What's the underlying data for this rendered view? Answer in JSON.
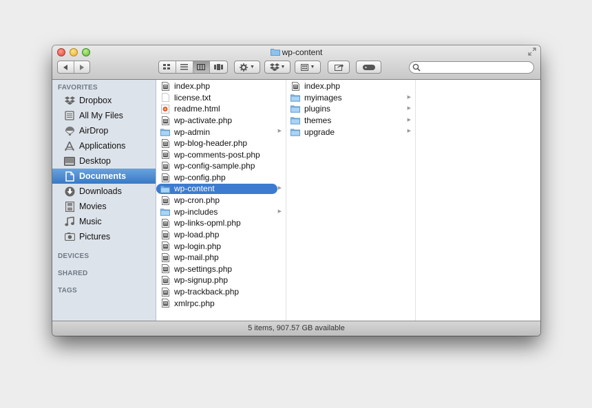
{
  "window": {
    "title": "wp-content"
  },
  "toolbar": {
    "search": {
      "placeholder": "",
      "value": ""
    }
  },
  "sidebar": {
    "favorites_header": "FAVORITES",
    "items": [
      {
        "label": "Dropbox",
        "icon": "dropbox-icon"
      },
      {
        "label": "All My Files",
        "icon": "all-files-icon"
      },
      {
        "label": "AirDrop",
        "icon": "airdrop-icon"
      },
      {
        "label": "Applications",
        "icon": "applications-icon"
      },
      {
        "label": "Desktop",
        "icon": "desktop-icon"
      },
      {
        "label": "Documents",
        "icon": "documents-icon",
        "selected": true
      },
      {
        "label": "Downloads",
        "icon": "downloads-icon"
      },
      {
        "label": "Movies",
        "icon": "movies-icon"
      },
      {
        "label": "Music",
        "icon": "music-icon"
      },
      {
        "label": "Pictures",
        "icon": "pictures-icon"
      }
    ],
    "devices_header": "DEVICES",
    "shared_header": "SHARED",
    "tags_header": "TAGS"
  },
  "column1": [
    {
      "name": "index.php",
      "type": "php"
    },
    {
      "name": "license.txt",
      "type": "txt"
    },
    {
      "name": "readme.html",
      "type": "html"
    },
    {
      "name": "wp-activate.php",
      "type": "php"
    },
    {
      "name": "wp-admin",
      "type": "folder"
    },
    {
      "name": "wp-blog-header.php",
      "type": "php"
    },
    {
      "name": "wp-comments-post.php",
      "type": "php"
    },
    {
      "name": "wp-config-sample.php",
      "type": "php"
    },
    {
      "name": "wp-config.php",
      "type": "php"
    },
    {
      "name": "wp-content",
      "type": "folder",
      "selected": true
    },
    {
      "name": "wp-cron.php",
      "type": "php"
    },
    {
      "name": "wp-includes",
      "type": "folder"
    },
    {
      "name": "wp-links-opml.php",
      "type": "php"
    },
    {
      "name": "wp-load.php",
      "type": "php"
    },
    {
      "name": "wp-login.php",
      "type": "php"
    },
    {
      "name": "wp-mail.php",
      "type": "php"
    },
    {
      "name": "wp-settings.php",
      "type": "php"
    },
    {
      "name": "wp-signup.php",
      "type": "php"
    },
    {
      "name": "wp-trackback.php",
      "type": "php"
    },
    {
      "name": "xmlrpc.php",
      "type": "php"
    }
  ],
  "column2": [
    {
      "name": "index.php",
      "type": "php"
    },
    {
      "name": "myimages",
      "type": "folder"
    },
    {
      "name": "plugins",
      "type": "folder"
    },
    {
      "name": "themes",
      "type": "folder"
    },
    {
      "name": "upgrade",
      "type": "folder"
    }
  ],
  "status": {
    "text": "5 items, 907.57 GB available"
  },
  "colors": {
    "selection": "#3d7bd0",
    "sidebar_bg": "#dde3ea",
    "folder": "#8ec3ee"
  }
}
